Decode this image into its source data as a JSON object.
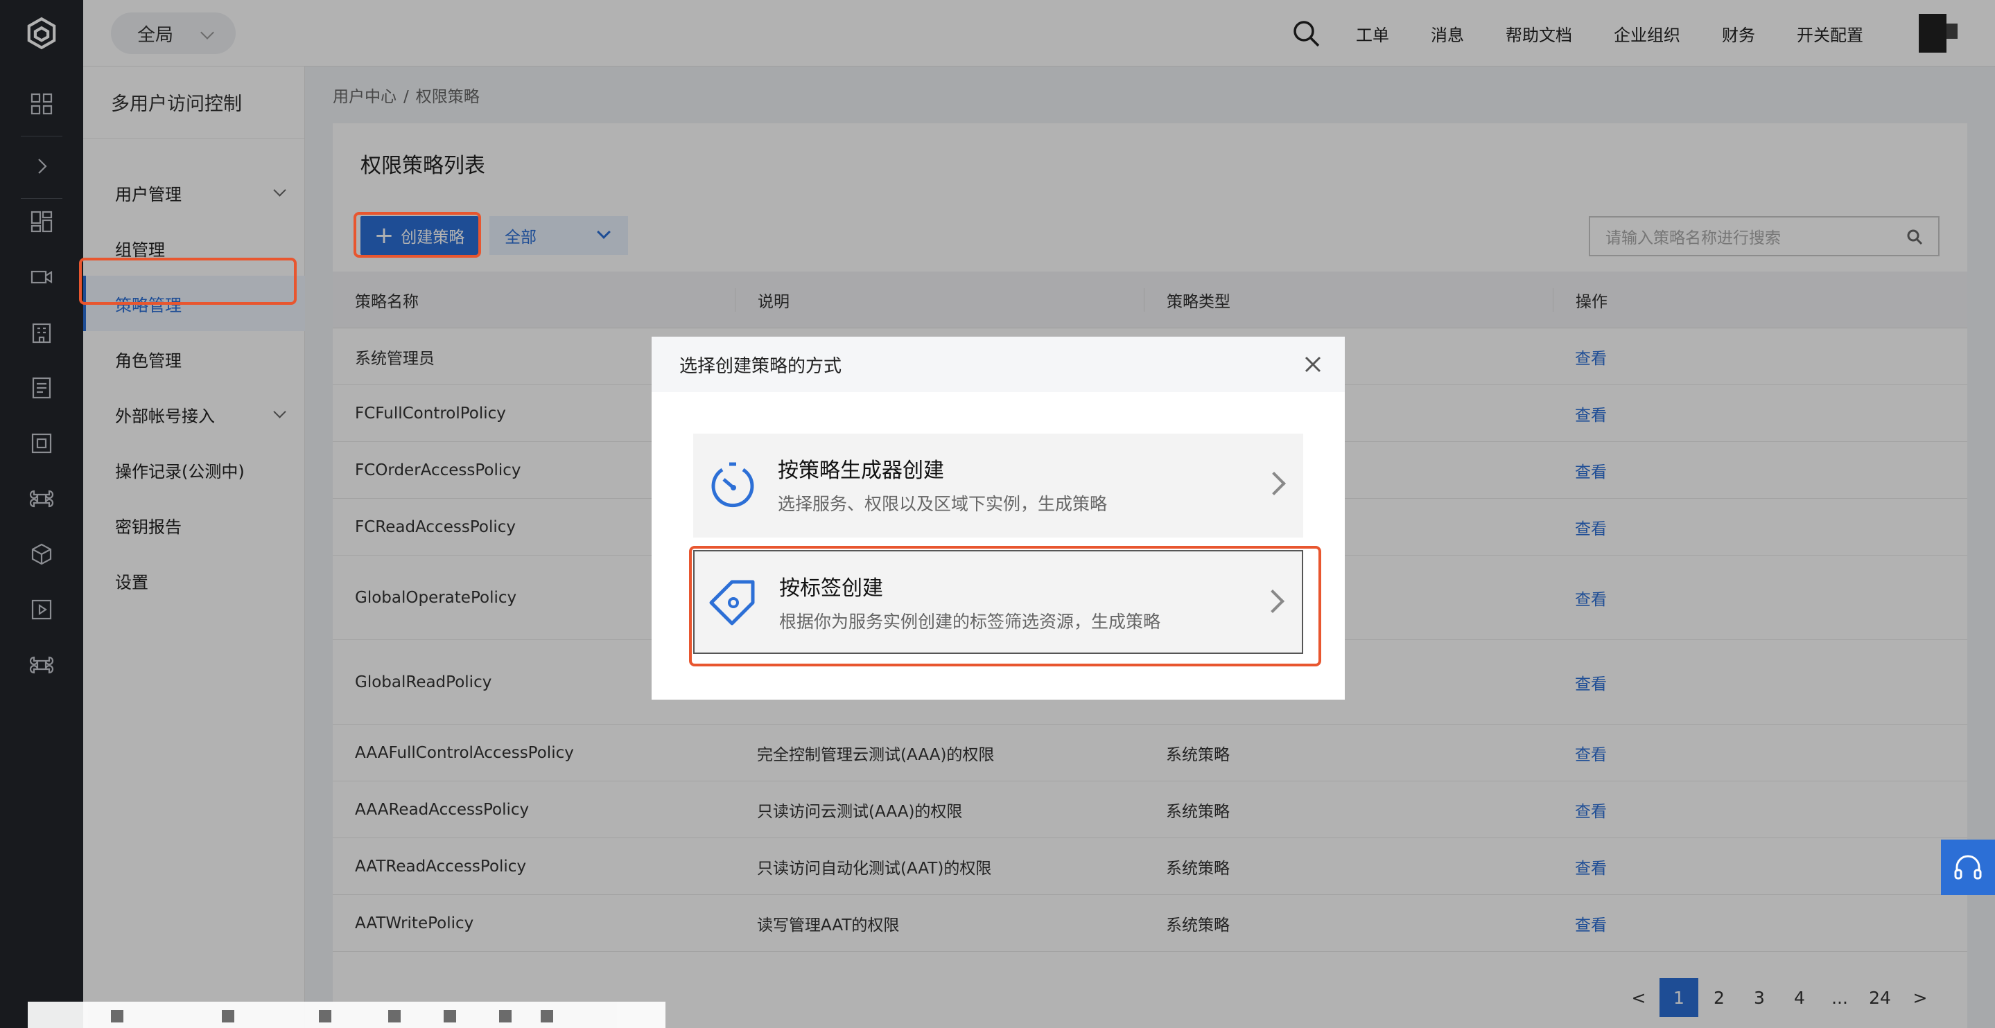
{
  "topbar": {
    "scope_label": "全局",
    "nav": [
      "工单",
      "消息",
      "帮助文档",
      "企业组织",
      "财务",
      "开关配置"
    ]
  },
  "sidebar": {
    "title": "多用户访问控制",
    "items": [
      {
        "label": "用户管理",
        "expandable": true
      },
      {
        "label": "组管理"
      },
      {
        "label": "策略管理",
        "active": true
      },
      {
        "label": "角色管理"
      },
      {
        "label": "外部帐号接入",
        "expandable": true
      },
      {
        "label": "操作记录(公测中)"
      },
      {
        "label": "密钥报告"
      },
      {
        "label": "设置"
      }
    ]
  },
  "breadcrumb": {
    "root": "用户中心",
    "separator": "/",
    "current": "权限策略"
  },
  "main": {
    "title": "权限策略列表",
    "create_button": "创建策略",
    "filter_select": "全部",
    "search_placeholder": "请输入策略名称进行搜索",
    "columns": [
      "策略名称",
      "说明",
      "策略类型",
      "操作"
    ],
    "rows": [
      {
        "name": "系统管理员",
        "desc": "",
        "type": "",
        "action": "查看"
      },
      {
        "name": "FCFullControlPolicy",
        "desc": "",
        "type": "",
        "action": "查看"
      },
      {
        "name": "FCOrderAccessPolicy",
        "desc": "",
        "type": "",
        "action": "查看"
      },
      {
        "name": "FCReadAccessPolicy",
        "desc": "",
        "type": "",
        "action": "查看"
      },
      {
        "name": "GlobalOperatePolicy",
        "desc": "",
        "type": "",
        "action": "查看"
      },
      {
        "name": "GlobalReadPolicy",
        "desc": "",
        "type": "",
        "action": "查看"
      },
      {
        "name": "AAAFullControlAccessPolicy",
        "desc": "完全控制管理云测试(AAA)的权限",
        "type": "系统策略",
        "action": "查看"
      },
      {
        "name": "AAAReadAccessPolicy",
        "desc": "只读访问云测试(AAA)的权限",
        "type": "系统策略",
        "action": "查看"
      },
      {
        "name": "AATReadAccessPolicy",
        "desc": "只读访问自动化测试(AAT)的权限",
        "type": "系统策略",
        "action": "查看"
      },
      {
        "name": "AATWritePolicy",
        "desc": "读写管理AAT的权限",
        "type": "系统策略",
        "action": "查看"
      }
    ],
    "pagination": {
      "prev": "<",
      "pages": [
        "1",
        "2",
        "3",
        "4",
        "...",
        "24"
      ],
      "current": "1",
      "next": ">"
    }
  },
  "modal": {
    "title": "选择创建策略的方式",
    "options": [
      {
        "title": "按策略生成器创建",
        "desc": "选择服务、权限以及区域下实例，生成策略",
        "icon": "generator-dial-icon"
      },
      {
        "title": "按标签创建",
        "desc": "根据你为服务实例创建的标签筛选资源，生成策略",
        "icon": "tag-icon"
      }
    ]
  },
  "colors": {
    "accent": "#2c6fd6",
    "highlight": "#e8562f",
    "rail": "#23262c"
  }
}
